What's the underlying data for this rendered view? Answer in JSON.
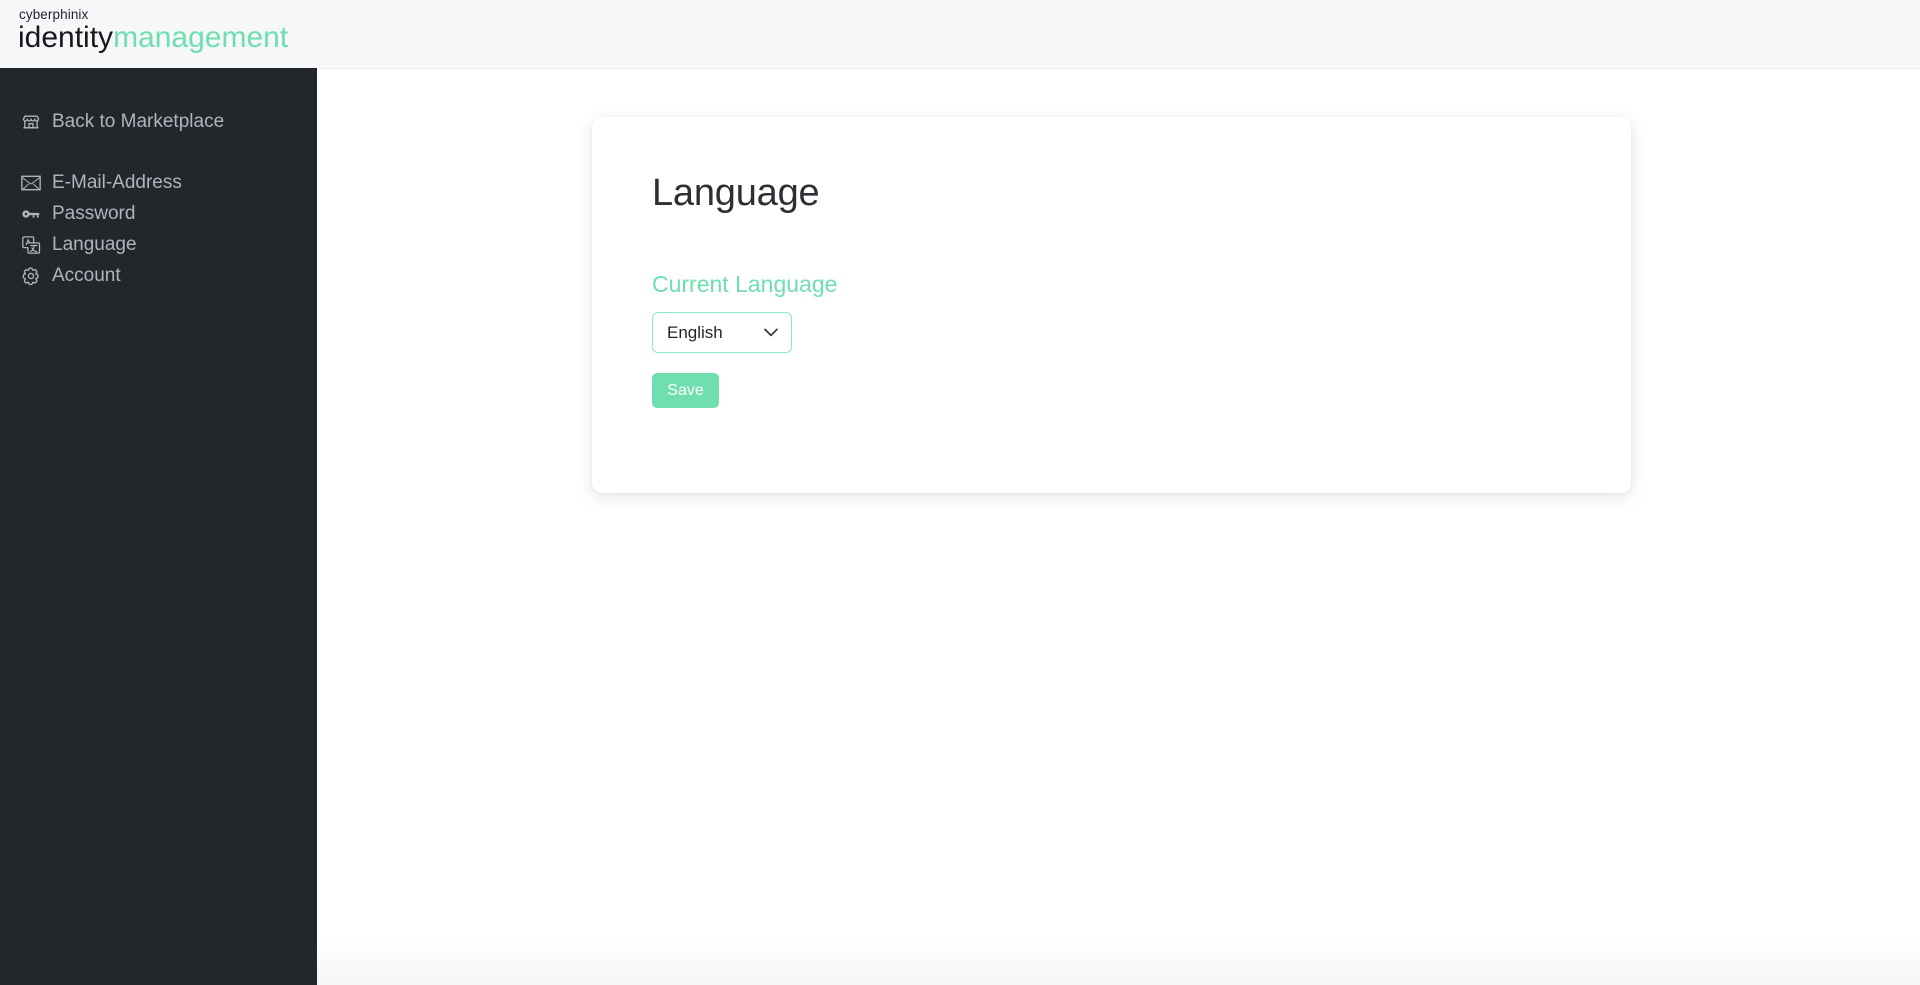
{
  "header": {
    "logo": {
      "brand_small": "cyberphinix",
      "word_primary": "identity",
      "word_accent": "management"
    }
  },
  "sidebar": {
    "items": [
      {
        "label": "Back to Marketplace",
        "icon": "storefront-icon",
        "key": "back-to-marketplace"
      },
      {
        "label": "E-Mail-Address",
        "icon": "envelope-icon",
        "key": "email-address"
      },
      {
        "label": "Password",
        "icon": "key-icon",
        "key": "password"
      },
      {
        "label": "Language",
        "icon": "translate-icon",
        "key": "language"
      },
      {
        "label": "Account",
        "icon": "gear-icon",
        "key": "account"
      }
    ]
  },
  "main": {
    "card": {
      "title": "Language",
      "field_label": "Current Language",
      "language_select": {
        "value": "English",
        "options": [
          "English"
        ],
        "chevron_icon": "chevron-down-icon"
      },
      "save_label": "Save"
    }
  },
  "colors": {
    "accent_green": "#6fdfb0",
    "select_border_green": "#8ee8c2",
    "sidebar_bg": "#23272b",
    "sidebar_text": "#adb5bd",
    "header_bg": "#f6f7f9",
    "title_text": "#2c3034",
    "page_bg": "#ffffff"
  }
}
